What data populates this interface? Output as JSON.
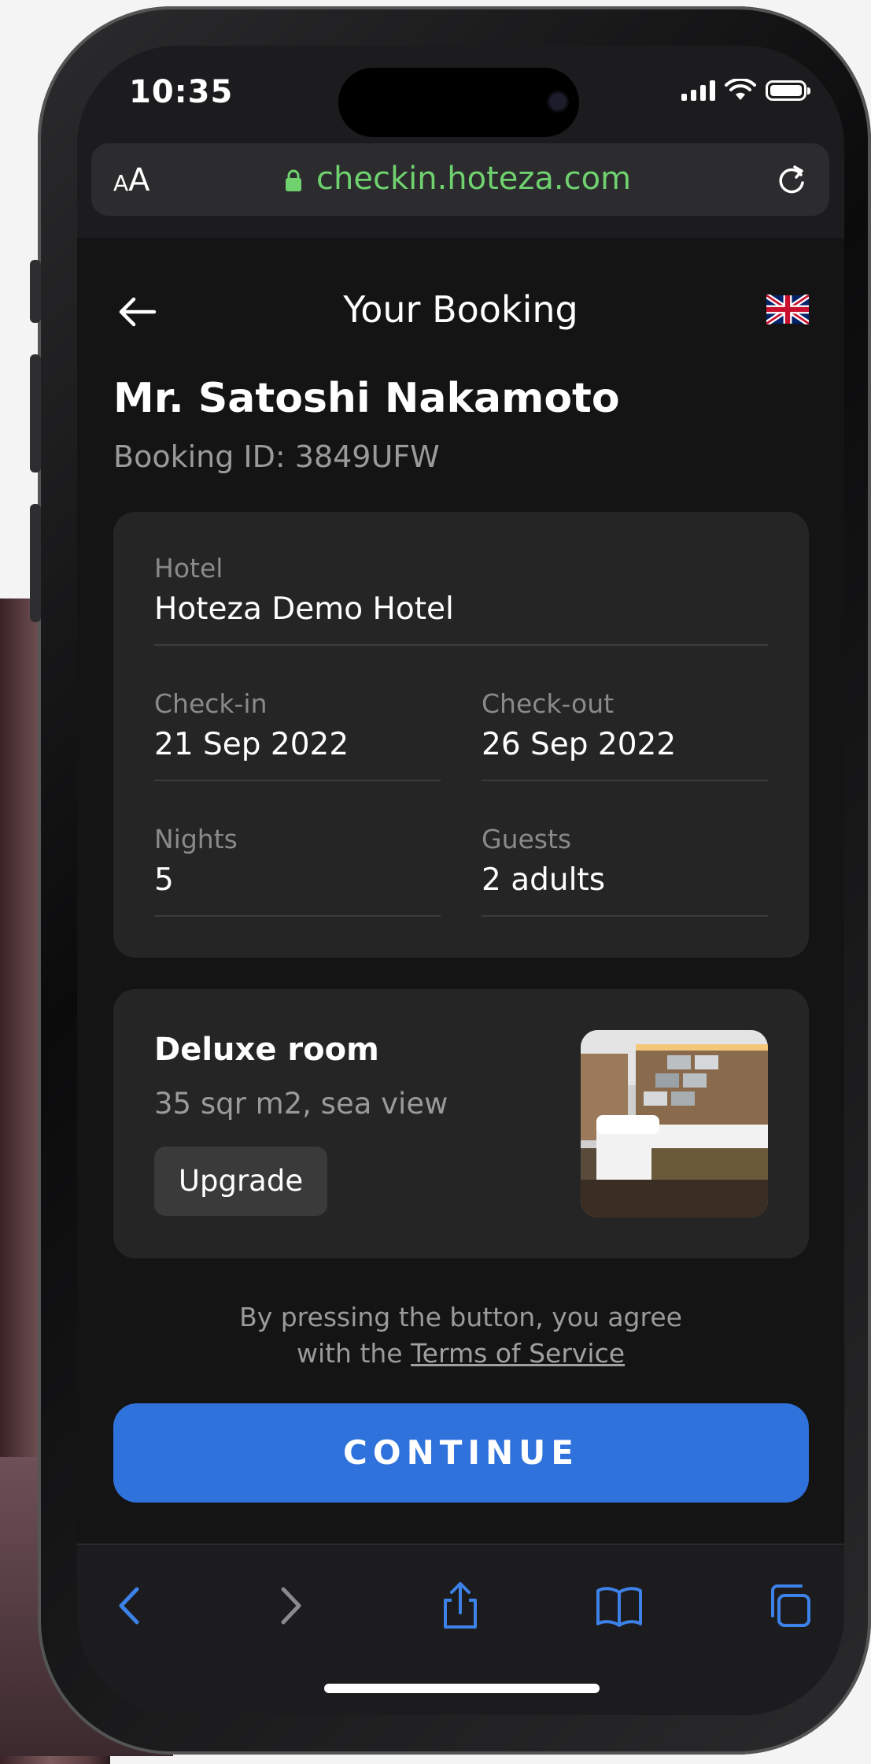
{
  "status_bar": {
    "time": "10:35"
  },
  "browser": {
    "text_size_small": "A",
    "text_size_large": "A",
    "url": "checkin.hoteza.com"
  },
  "header": {
    "title": "Your Booking"
  },
  "guest": {
    "name": "Mr. Satoshi Nakamoto",
    "booking_id": "Booking ID: 3849UFW"
  },
  "details": {
    "hotel_label": "Hotel",
    "hotel_value": "Hoteza Demo Hotel",
    "checkin_label": "Check-in",
    "checkin_value": "21 Sep 2022",
    "checkout_label": "Check-out",
    "checkout_value": "26 Sep 2022",
    "nights_label": "Nights",
    "nights_value": "5",
    "guests_label": "Guests",
    "guests_value": "2 adults"
  },
  "room": {
    "title": "Deluxe room",
    "description": "35 sqr m2, sea view",
    "upgrade_label": "Upgrade"
  },
  "terms": {
    "line1": "By pressing the button, you agree",
    "line2_prefix": "with the ",
    "link": "Terms of Service"
  },
  "continue_label": "CONTINUE",
  "colors": {
    "accent": "#2f72dc",
    "url_green": "#6fd26f",
    "background": "#141414",
    "card": "#252525",
    "toolbar_icon": "#3d82e8"
  },
  "icons": [
    "back-arrow-icon",
    "uk-flag-icon",
    "lock-icon",
    "reload-icon",
    "safari-back-icon",
    "safari-forward-icon",
    "share-icon",
    "bookmarks-icon",
    "tabs-icon"
  ]
}
